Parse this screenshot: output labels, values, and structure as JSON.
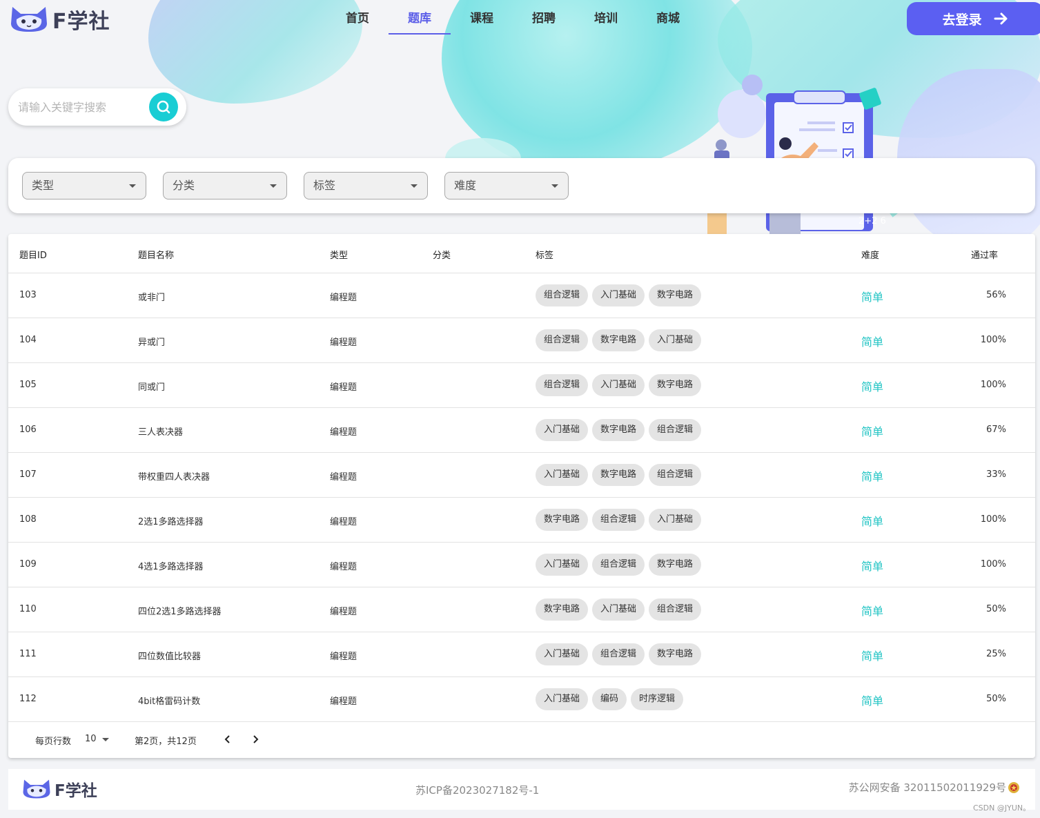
{
  "header": {
    "brand": "F学社",
    "nav": [
      {
        "label": "首页",
        "active": false
      },
      {
        "label": "题库",
        "active": true
      },
      {
        "label": "课程",
        "active": false
      },
      {
        "label": "招聘",
        "active": false
      },
      {
        "label": "培训",
        "active": false
      },
      {
        "label": "商城",
        "active": false
      }
    ],
    "login_label": "去登录"
  },
  "search": {
    "placeholder": "请输入关键字搜索",
    "value": ""
  },
  "filters": [
    {
      "label": "类型"
    },
    {
      "label": "分类"
    },
    {
      "label": "标签"
    },
    {
      "label": "难度"
    }
  ],
  "table": {
    "columns": [
      "题目ID",
      "题目名称",
      "类型",
      "分类",
      "标签",
      "难度",
      "通过率"
    ],
    "rows": [
      {
        "id": "103",
        "name": "或非门",
        "type": "编程题",
        "category": "",
        "tags": [
          "组合逻辑",
          "入门基础",
          "数字电路"
        ],
        "difficulty": "简单",
        "rate": "56%"
      },
      {
        "id": "104",
        "name": "异或门",
        "type": "编程题",
        "category": "",
        "tags": [
          "组合逻辑",
          "数字电路",
          "入门基础"
        ],
        "difficulty": "简单",
        "rate": "100%"
      },
      {
        "id": "105",
        "name": "同或门",
        "type": "编程题",
        "category": "",
        "tags": [
          "组合逻辑",
          "入门基础",
          "数字电路"
        ],
        "difficulty": "简单",
        "rate": "100%"
      },
      {
        "id": "106",
        "name": "三人表决器",
        "type": "编程题",
        "category": "",
        "tags": [
          "入门基础",
          "数字电路",
          "组合逻辑"
        ],
        "difficulty": "简单",
        "rate": "67%"
      },
      {
        "id": "107",
        "name": "带权重四人表决器",
        "type": "编程题",
        "category": "",
        "tags": [
          "入门基础",
          "数字电路",
          "组合逻辑"
        ],
        "difficulty": "简单",
        "rate": "33%"
      },
      {
        "id": "108",
        "name": "2选1多路选择器",
        "type": "编程题",
        "category": "",
        "tags": [
          "数字电路",
          "组合逻辑",
          "入门基础"
        ],
        "difficulty": "简单",
        "rate": "100%"
      },
      {
        "id": "109",
        "name": "4选1多路选择器",
        "type": "编程题",
        "category": "",
        "tags": [
          "入门基础",
          "组合逻辑",
          "数字电路"
        ],
        "difficulty": "简单",
        "rate": "100%"
      },
      {
        "id": "110",
        "name": "四位2选1多路选择器",
        "type": "编程题",
        "category": "",
        "tags": [
          "数字电路",
          "入门基础",
          "组合逻辑"
        ],
        "difficulty": "简单",
        "rate": "50%"
      },
      {
        "id": "111",
        "name": "四位数值比较器",
        "type": "编程题",
        "category": "",
        "tags": [
          "入门基础",
          "组合逻辑",
          "数字电路"
        ],
        "difficulty": "简单",
        "rate": "25%"
      },
      {
        "id": "112",
        "name": "4bit格雷码计数",
        "type": "编程题",
        "category": "",
        "tags": [
          "入门基础",
          "编码",
          "时序逻辑"
        ],
        "difficulty": "简单",
        "rate": "50%"
      }
    ]
  },
  "pagination": {
    "rows_per_page_label": "每页行数",
    "rows_per_page": "10",
    "page_info": "第2页，共12页"
  },
  "footer": {
    "brand": "F学社",
    "icp": "苏ICP备2023027182号-1",
    "police": "苏公网安备 32011502011929号"
  },
  "watermark": "CSDN @JYUN。",
  "colors": {
    "accent": "#5b5ee8",
    "search_button": "#19cdd4",
    "difficulty_easy": "#22c4c4"
  },
  "icons": {
    "logo": "cat-logo-icon",
    "login_arrow": "arrow-right-icon",
    "search": "search-icon",
    "dropdown": "caret-down-icon",
    "prev_page": "chevron-left-icon",
    "next_page": "chevron-right-icon",
    "police": "police-emblem-icon"
  }
}
